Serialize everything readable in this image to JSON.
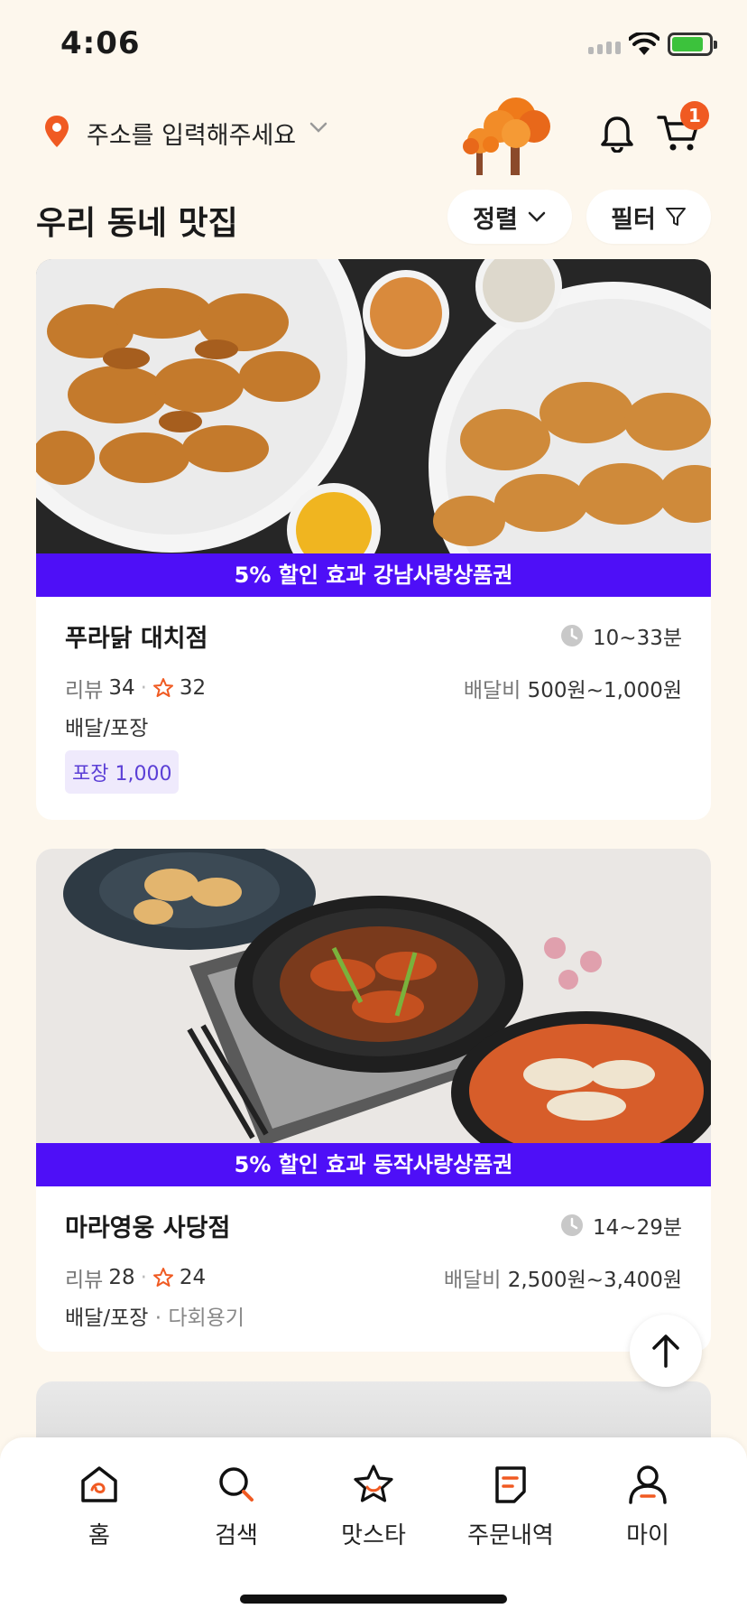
{
  "status_bar": {
    "time": "4:06"
  },
  "header": {
    "address_placeholder": "주소를 입력해주세요",
    "cart_count": "1"
  },
  "section": {
    "title": "우리 동네 맛집",
    "sort_label": "정렬",
    "filter_label": "필터"
  },
  "stores": [
    {
      "promo": "5% 할인 효과 강남사랑상품권",
      "name": "푸라닭 대치점",
      "delivery_time": "10~33분",
      "review_label": "리뷰",
      "review_count": "34",
      "rating_count": "32",
      "fee_label": "배달비",
      "fee_range": "500원~1,000원",
      "service_type": "배달/포장",
      "tag": "포장 1,000"
    },
    {
      "promo": "5% 할인 효과 동작사랑상품권",
      "name": "마라영웅 사당점",
      "delivery_time": "14~29분",
      "review_label": "리뷰",
      "review_count": "28",
      "rating_count": "24",
      "fee_label": "배달비",
      "fee_range": "2,500원~3,400원",
      "service_type": "배달/포장",
      "service_extra": "다회용기"
    }
  ],
  "bottom_nav": [
    {
      "label": "홈",
      "icon": "home-icon"
    },
    {
      "label": "검색",
      "icon": "search-icon"
    },
    {
      "label": "맛스타",
      "icon": "star-icon"
    },
    {
      "label": "주문내역",
      "icon": "order-list-icon"
    },
    {
      "label": "마이",
      "icon": "profile-icon"
    }
  ],
  "colors": {
    "accent": "#f05a22",
    "promo": "#4e0ff7",
    "background": "#fdf7ed"
  }
}
